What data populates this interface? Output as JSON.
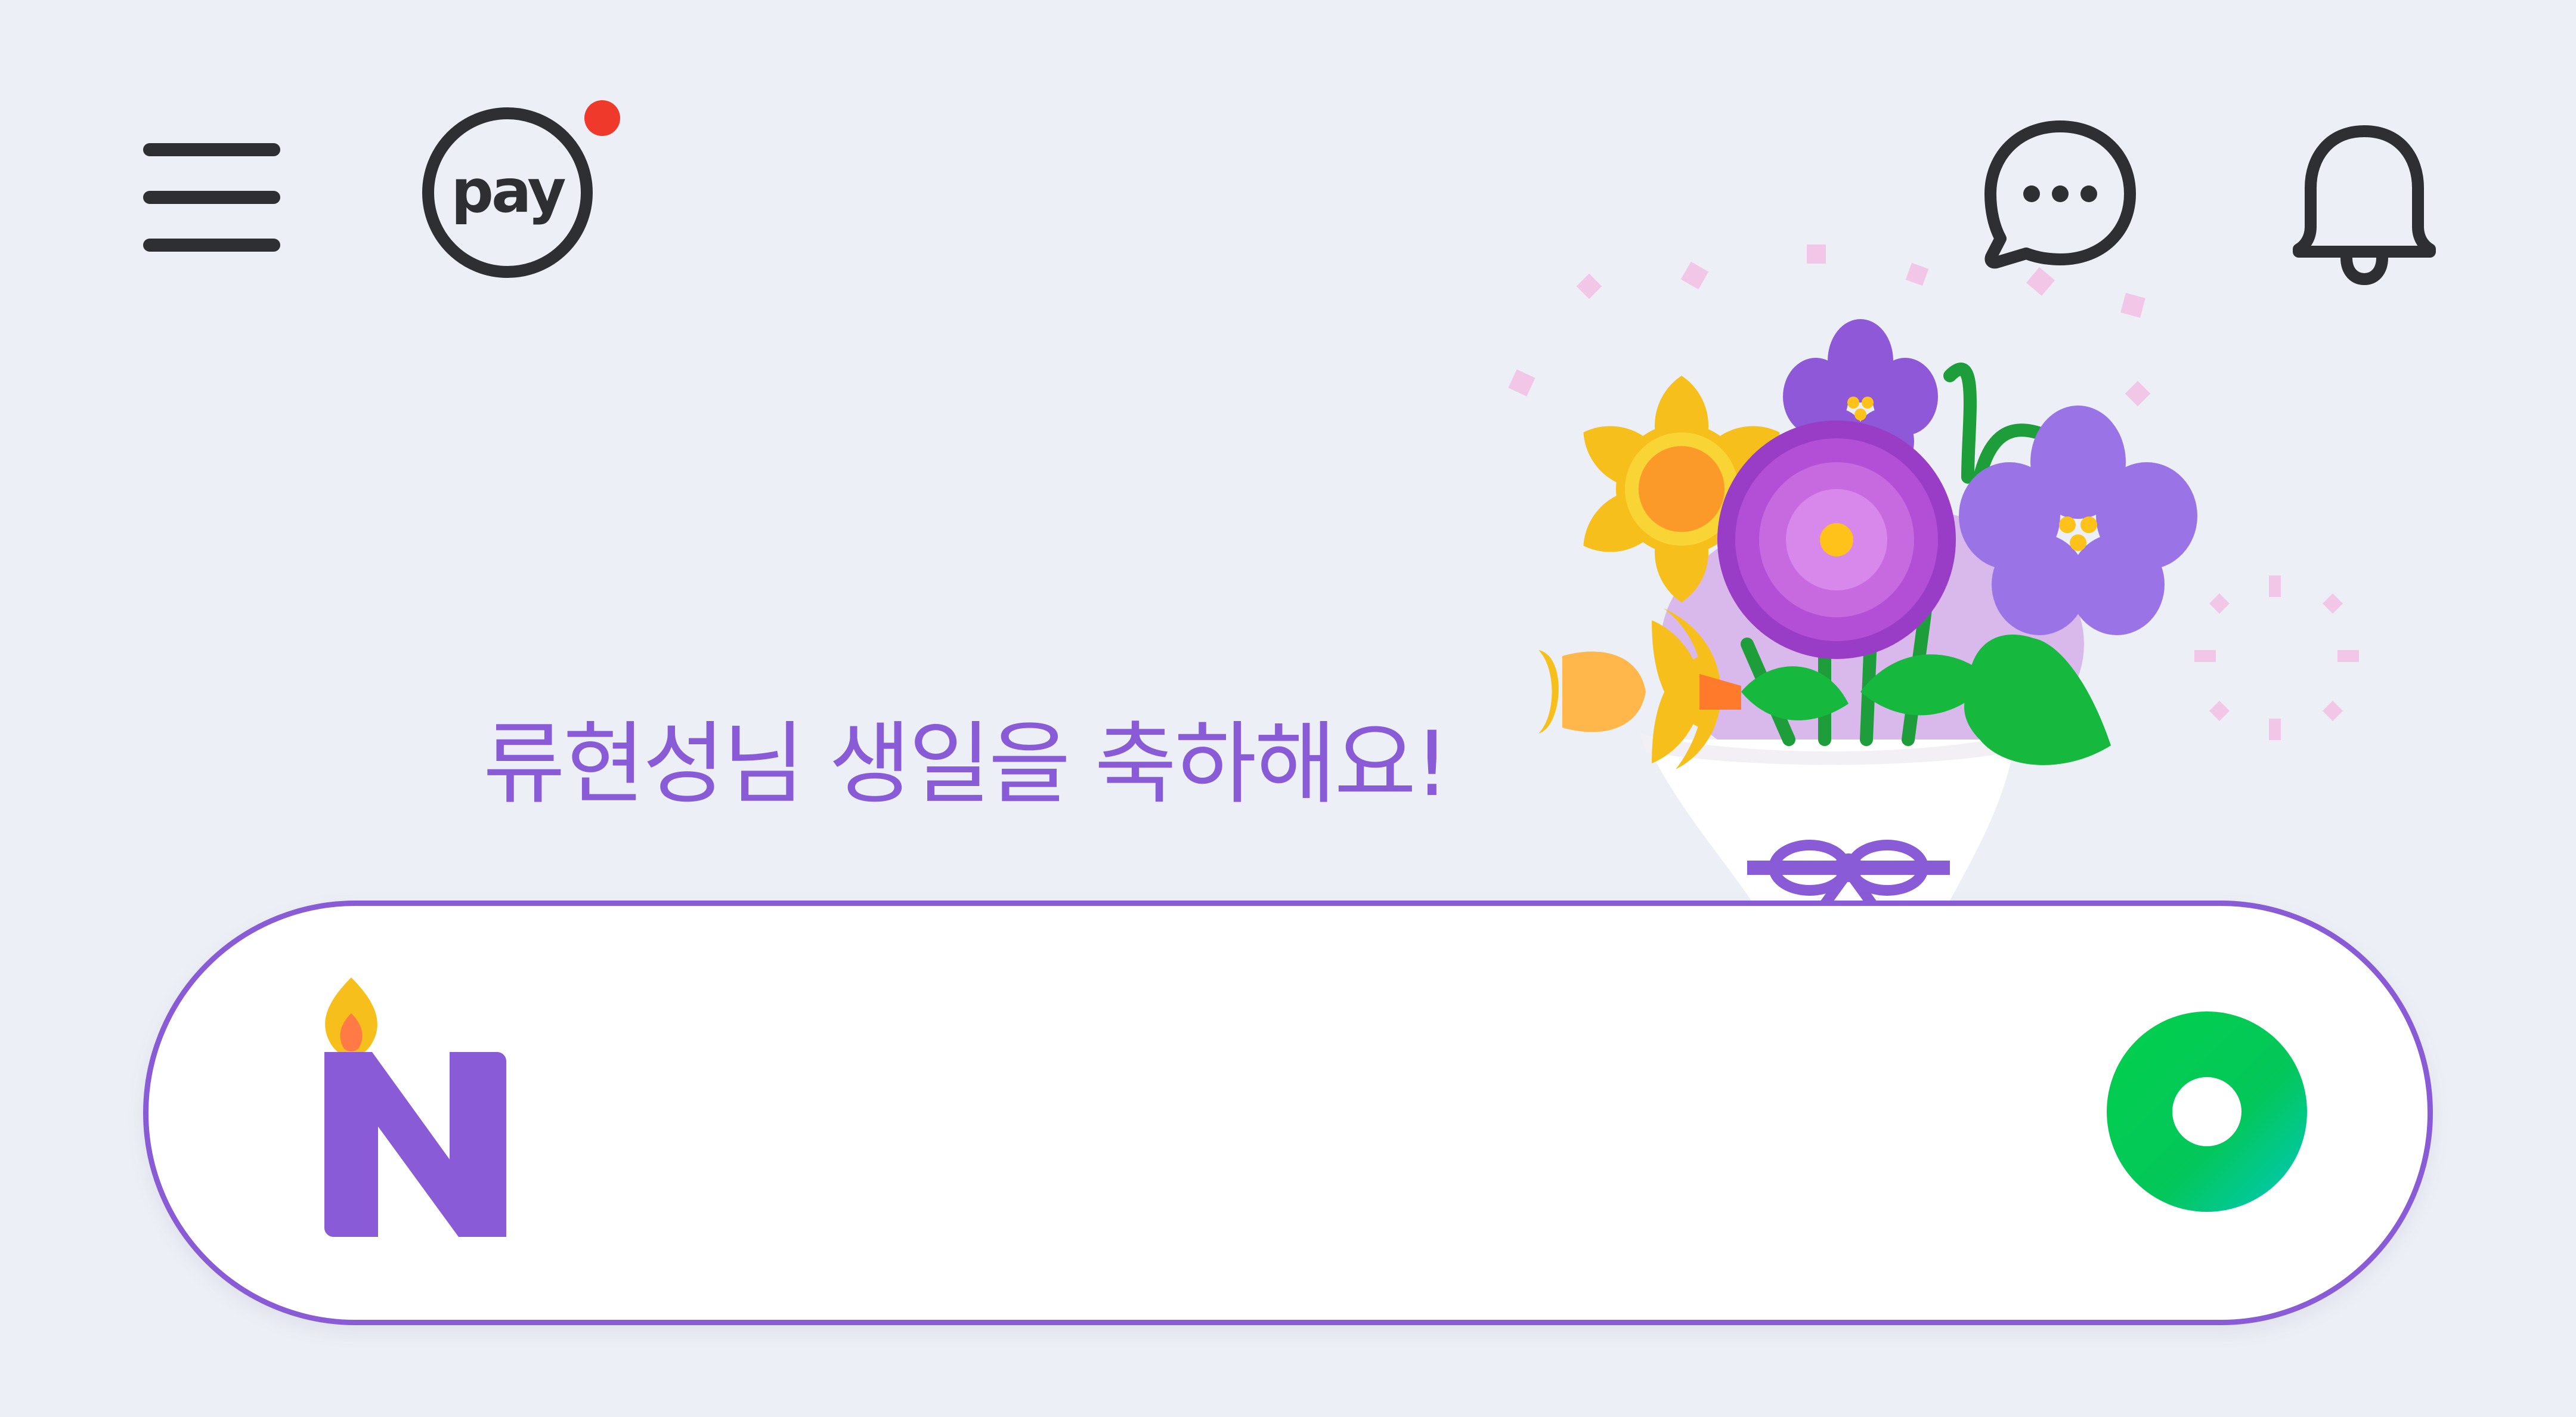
{
  "header": {
    "pay_label": "pay",
    "pay_notification": true
  },
  "greeting": {
    "text": "류현성님 생일을 축하해요!"
  },
  "search": {
    "value": "",
    "placeholder": ""
  },
  "icons": {
    "menu": "hamburger-menu-icon",
    "pay": "pay-icon",
    "chat": "chat-bubble-icon",
    "bell": "bell-icon",
    "bouquet": "flower-bouquet-illustration",
    "logo": "naver-n-birthday-candle-logo",
    "green_action": "green-ring-icon"
  },
  "colors": {
    "background": "#eceff5",
    "accent": "#8a5bd6",
    "icon": "#2d2f33",
    "notification": "#ef3a2b",
    "green": "#03c75a"
  }
}
